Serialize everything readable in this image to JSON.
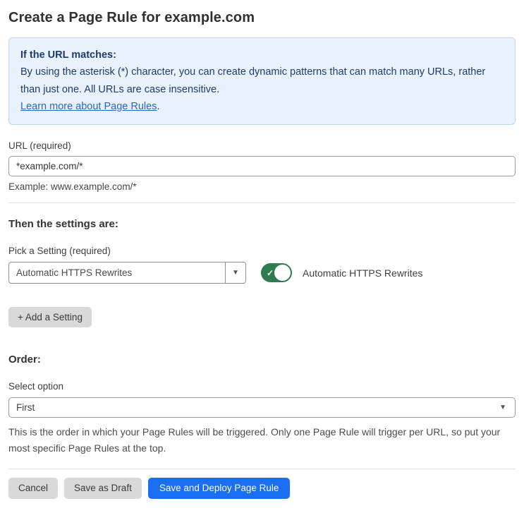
{
  "page": {
    "title": "Create a Page Rule for example.com"
  },
  "info_box": {
    "heading": "If the URL matches:",
    "body": "By using the asterisk (*) character, you can create dynamic patterns that can match many URLs, rather than just one. All URLs are case insensitive.",
    "link_label": "Learn more about Page Rules",
    "link_suffix": "."
  },
  "url_field": {
    "label": "URL (required)",
    "value": "*example.com/*",
    "helper": "Example: www.example.com/*"
  },
  "settings_section": {
    "heading": "Then the settings are:",
    "picker_label": "Pick a Setting (required)",
    "picker_value": "Automatic HTTPS Rewrites",
    "picker_caret": "▼",
    "toggle_state": "on",
    "toggle_check": "✓",
    "toggle_label": "Automatic HTTPS Rewrites",
    "add_button_label": "+ Add a Setting"
  },
  "order_section": {
    "heading": "Order:",
    "select_label": "Select option",
    "select_value": "First",
    "select_caret": "▼",
    "helper": "This is the order in which your Page Rules will be triggered. Only one Page Rule will trigger per URL, so put your most specific Page Rules at the top."
  },
  "footer": {
    "cancel_label": "Cancel",
    "save_draft_label": "Save as Draft",
    "save_deploy_label": "Save and Deploy Page Rule"
  },
  "colors": {
    "accent_blue": "#1a6ef2",
    "toggle_green": "#2e7d4e",
    "info_background": "#e9f2fc",
    "info_border": "#bdd8f2",
    "info_text": "#1d3c6d",
    "link_blue": "#2867c8",
    "button_gray": "#d9d9d9"
  }
}
